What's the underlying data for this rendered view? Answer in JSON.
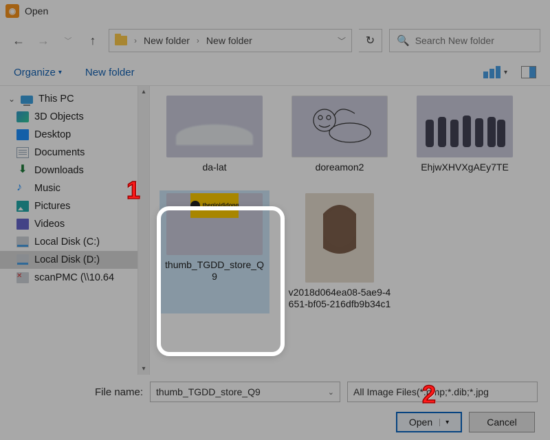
{
  "window": {
    "title": "Open"
  },
  "nav": {
    "crumbs": [
      "New folder",
      "New folder"
    ],
    "search_placeholder": "Search New folder"
  },
  "toolbar": {
    "organize": "Organize",
    "newfolder": "New folder"
  },
  "tree": {
    "root": "This PC",
    "items": [
      "3D Objects",
      "Desktop",
      "Documents",
      "Downloads",
      "Music",
      "Pictures",
      "Videos",
      "Local Disk (C:)",
      "Local Disk (D:)",
      "scanPMC (\\\\10.64"
    ]
  },
  "files": [
    {
      "name": "da-lat"
    },
    {
      "name": "doreamon2"
    },
    {
      "name": "EhjwXHVXgAEy7TE"
    },
    {
      "name": "thumb_TGDD_store_Q9",
      "selected": true,
      "store_sign": "thegioididong"
    },
    {
      "name": "v2018d064ea08-5ae9-4651-bf05-216dfb9b34c1"
    }
  ],
  "bottom": {
    "filename_label": "File name:",
    "filename_value": "thumb_TGDD_store_Q9",
    "type_filter": "All Image Files(*.bmp;*.dib;*.jpg",
    "open": "Open",
    "cancel": "Cancel"
  },
  "annotations": {
    "one": "1",
    "two": "2"
  }
}
